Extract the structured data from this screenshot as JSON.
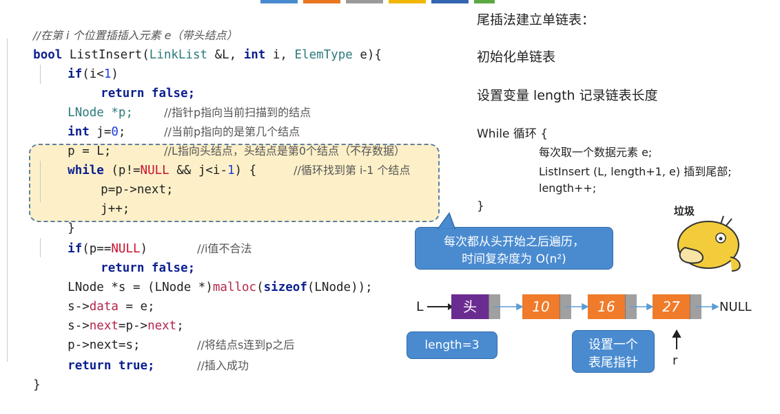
{
  "code": {
    "comment_title": "//在第 i 个位置插插入元素 e（带头结点）",
    "sig_kw_bool": "bool",
    "sig_name": " ListInsert(",
    "sig_type1": "LinkList",
    "sig_mid1": " &L, ",
    "sig_kw_int": "int",
    "sig_mid2": " i, ",
    "sig_type2": "ElemType",
    "sig_end": " e){",
    "l3_kw": "if",
    "l3_a": "(i<",
    "l3_num": "1",
    "l3_b": ")",
    "l4_kw": "return false;",
    "l5_a": "LNode *p;",
    "l5_cm": "//指针p指向当前扫描到的结点",
    "l6_kw": "int",
    "l6_a": " j=",
    "l6_num": "0",
    "l6_b": ";",
    "l6_cm": "//当前p指向的是第几个结点",
    "l7_a": "p = L;",
    "l7_cm": "//L指向头结点，头结点是第0个结点（不存数据）",
    "l8_kw": "while",
    "l8_a": " (p!=",
    "l8_null": "NULL",
    "l8_b": " && j<i-",
    "l8_num": "1",
    "l8_c": ") {",
    "l8_cm": "//循环找到第 i-1 个结点",
    "l9": "p=p->next;",
    "l10": "j++;",
    "l11": "}",
    "l12_kw": "if",
    "l12_a": "(p==",
    "l12_null": "NULL",
    "l12_b": ")",
    "l12_cm": "//i值不合法",
    "l13_kw": "return false;",
    "l14_a": "LNode *s = (LNode *)",
    "l14_fn": "malloc",
    "l14_b": "(",
    "l14_kw": "sizeof",
    "l14_c": "(LNode));",
    "l15_a": "s->",
    "l15_field": "data",
    "l15_b": " = e;",
    "l16_a": "s->",
    "l16_field": "next",
    "l16_b": "=p->",
    "l16_field2": "next",
    "l16_c": ";",
    "l17_a": "p->next=s;",
    "l17_cm": "//将结点s连到p之后",
    "l18_kw": "return true;",
    "l18_cm": "//插入成功",
    "l19": "}"
  },
  "right_panel": {
    "heading": "尾插法建立单链表：",
    "step_init": "初始化单链表",
    "step_len": "设置变量 length 记录链表长度",
    "while_open": "While 循环 {",
    "loop1": "每次取一个数据元素 e;",
    "loop2": "ListInsert (L, length+1, e) 插到尾部;",
    "loop3": "length++;",
    "while_close": "}"
  },
  "callouts": {
    "traverse_line1": "每次都从头开始之后遍历，",
    "traverse_line2": "时间复杂度为 O(n²)",
    "length": "length=3",
    "tail_line1": "设置一个",
    "tail_line2": "表尾指针"
  },
  "linked_list": {
    "head_label": "L",
    "head_node": "头",
    "nodes": [
      "10",
      "16",
      "27"
    ],
    "null_label": "NULL",
    "tail_label": "r",
    "head_color": "#6b2c91",
    "node_color": "#f07b2a"
  },
  "sticker": {
    "caption": "垃圾"
  },
  "colors": {
    "highlight_bg": "#fdf0c8",
    "callout_bg": "#4a8bd0"
  }
}
